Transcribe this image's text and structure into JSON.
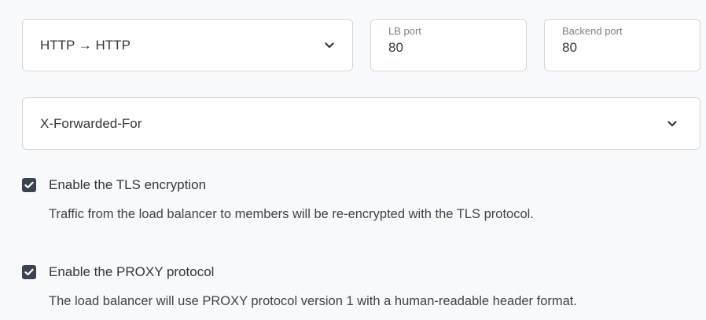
{
  "protocol_select": {
    "value": "HTTP → HTTP",
    "icon": "chevron-down-icon"
  },
  "lb_port": {
    "label": "LB port",
    "value": "80"
  },
  "backend_port": {
    "label": "Backend port",
    "value": "80"
  },
  "header_select": {
    "value": "X-Forwarded-For",
    "icon": "chevron-down-icon"
  },
  "tls": {
    "checked": true,
    "label": "Enable the TLS encryption",
    "description": "Traffic from the load balancer to members will be re-encrypted with the TLS protocol."
  },
  "proxy": {
    "checked": true,
    "label": "Enable the PROXY protocol",
    "description": "The load balancer will use PROXY protocol version 1 with a human-readable header format."
  },
  "colors": {
    "page_background": "#f8f9fa",
    "field_border": "#d3d6da",
    "checkbox_fill": "#3b4351"
  }
}
